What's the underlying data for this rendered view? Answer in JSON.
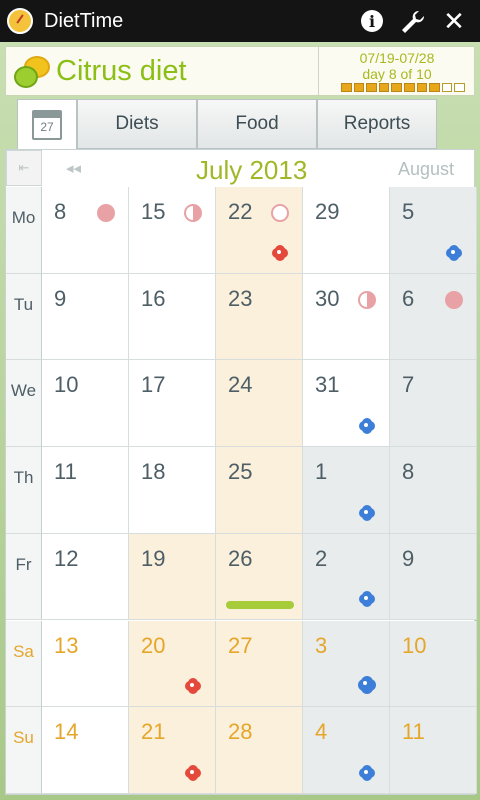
{
  "titlebar": {
    "app_name": "DietTime"
  },
  "header": {
    "diet_name": "Citrus diet",
    "date_range": "07/19-07/28",
    "day_progress": "day 8 of 10",
    "progress": {
      "completed_days": 8,
      "total_days": 10
    }
  },
  "tabs": [
    {
      "label": ""
    },
    {
      "label": "Diets"
    },
    {
      "label": "Food"
    },
    {
      "label": "Reports"
    }
  ],
  "calendar_icon_day": "27",
  "calendar": {
    "month_title": "July 2013",
    "next_month_label": "August",
    "first_symbol": "⇤",
    "prev_symbol": "◂◂",
    "weekdays": [
      "Mo",
      "Tu",
      "We",
      "Th",
      "Fr",
      "Sa",
      "Su"
    ],
    "weeks": [
      [
        "8",
        "9",
        "10",
        "11",
        "12",
        "13",
        "14"
      ],
      [
        "15",
        "16",
        "17",
        "18",
        "19",
        "20",
        "21"
      ],
      [
        "22",
        "23",
        "24",
        "25",
        "26",
        "27",
        "28"
      ],
      [
        "29",
        "30",
        "31",
        "1",
        "2",
        "3",
        "4"
      ],
      [
        "5",
        "6",
        "7",
        "8",
        "9",
        "10",
        "11"
      ]
    ]
  },
  "colors": {
    "accent_green": "#8cbf16",
    "weekend_orange": "#e5a62a",
    "diet_day_bg": "#fbf0dc",
    "next_month_bg": "#e8ecec"
  }
}
